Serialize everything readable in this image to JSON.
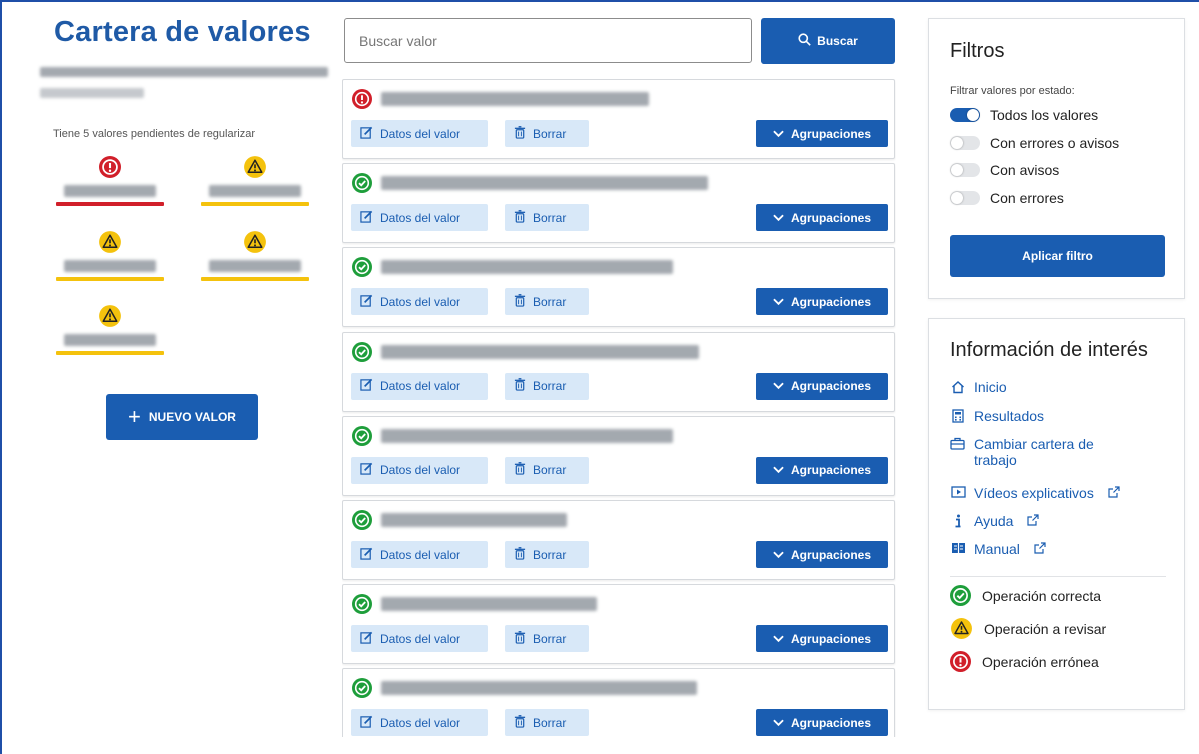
{
  "left": {
    "title": "Cartera de valores",
    "pending_text": "Tiene 5 valores pendientes de regularizar",
    "pending_items": [
      {
        "status": "error"
      },
      {
        "status": "warning"
      },
      {
        "status": "warning"
      },
      {
        "status": "warning"
      },
      {
        "status": "warning"
      }
    ],
    "new_button_label": "NUEVO VALOR"
  },
  "search": {
    "placeholder": "Buscar valor",
    "button_label": "Buscar"
  },
  "list": {
    "data_button_label": "Datos del valor",
    "delete_button_label": "Borrar",
    "group_button_label": "Agrupaciones",
    "items": [
      {
        "status": "error"
      },
      {
        "status": "ok"
      },
      {
        "status": "ok"
      },
      {
        "status": "ok"
      },
      {
        "status": "ok"
      },
      {
        "status": "ok"
      },
      {
        "status": "ok"
      },
      {
        "status": "ok"
      }
    ]
  },
  "filters": {
    "title": "Filtros",
    "hint": "Filtrar valores por estado:",
    "options": [
      {
        "label": "Todos los valores",
        "on": true
      },
      {
        "label": "Con errores o avisos",
        "on": false
      },
      {
        "label": "Con avisos",
        "on": false
      },
      {
        "label": "Con errores",
        "on": false
      }
    ],
    "apply_label": "Aplicar filtro"
  },
  "info": {
    "title": "Información de interés",
    "links": [
      {
        "label": "Inicio",
        "icon": "home-icon",
        "external": false
      },
      {
        "label": "Resultados",
        "icon": "calculator-icon",
        "external": false
      },
      {
        "label": "Cambiar cartera de trabajo",
        "icon": "briefcase-icon",
        "external": false
      },
      {
        "label": "Vídeos explicativos",
        "icon": "video-icon",
        "external": true
      },
      {
        "label": "Ayuda",
        "icon": "info-icon",
        "external": true
      },
      {
        "label": "Manual",
        "icon": "book-icon",
        "external": true
      }
    ],
    "legend": [
      {
        "label": "Operación correcta",
        "status": "ok"
      },
      {
        "label": "Operación a revisar",
        "status": "warning"
      },
      {
        "label": "Operación errónea",
        "status": "error"
      }
    ]
  },
  "colors": {
    "brand_blue": "#1a5db1",
    "title_blue": "#1f5aa6",
    "ok_green": "#1e9e3b",
    "warning_yellow": "#f4c20d",
    "error_red": "#d11f2a",
    "light_button_bg": "#d8e8f8"
  }
}
